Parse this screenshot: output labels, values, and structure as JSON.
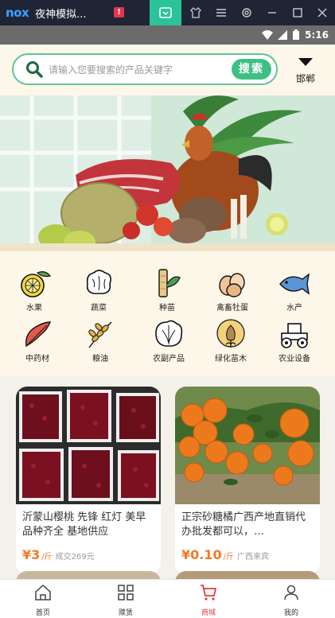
{
  "emulator": {
    "logo": "nox",
    "title": "夜神模拟...",
    "alert": "!"
  },
  "status_bar": {
    "time": "5:16"
  },
  "header": {
    "search_placeholder": "请输入您要搜索的产品关键字",
    "search_button": "搜索",
    "mail_label": "邯郸"
  },
  "categories": [
    {
      "label": "水果",
      "icon": "fruit-icon"
    },
    {
      "label": "蔬菜",
      "icon": "vegetable-icon"
    },
    {
      "label": "种苗",
      "icon": "seedling-icon"
    },
    {
      "label": "禽畜牡蛋",
      "icon": "eggs-icon"
    },
    {
      "label": "水产",
      "icon": "fish-icon"
    },
    {
      "label": "中药材",
      "icon": "herb-icon"
    },
    {
      "label": "粮油",
      "icon": "grain-icon"
    },
    {
      "label": "农副产品",
      "icon": "cabbage-icon"
    },
    {
      "label": "绿化苗木",
      "icon": "tree-icon"
    },
    {
      "label": "农业设备",
      "icon": "tractor-icon"
    }
  ],
  "products": [
    {
      "title": "沂蒙山樱桃 先锋 红灯 美早 品种齐全 基地供应",
      "price": "¥3",
      "unit": "/斤",
      "meta": "成交269元"
    },
    {
      "title": "正宗砂糖橘广西产地直销代办批发都可以，…",
      "price": "¥0.10",
      "unit": "/斤",
      "meta": "广西来宾"
    }
  ],
  "bottom_nav": [
    {
      "label": "首页",
      "icon": "home-icon"
    },
    {
      "label": "赎赁",
      "icon": "grid-icon"
    },
    {
      "label": "商城",
      "icon": "cart-icon",
      "active": true
    },
    {
      "label": "我的",
      "icon": "user-icon"
    }
  ],
  "colors": {
    "accent": "#3fbf85",
    "price": "#f07a2a",
    "nav_active": "#e83a3a"
  }
}
